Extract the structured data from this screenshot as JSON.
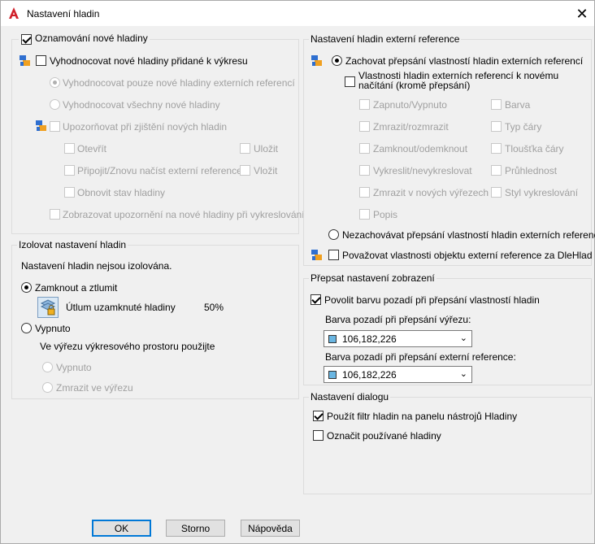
{
  "window": {
    "title": "Nastavení hladin",
    "close_icon": "close-icon"
  },
  "new_layers": {
    "legend": "Oznamování nové hladiny",
    "evaluate": "Vyhodnocovat nové hladiny přidané k výkresu",
    "eval_xref": "Vyhodnocovat pouze nové hladiny externích referencí",
    "eval_all": "Vyhodnocovat všechny nové hladiny",
    "notify": "Upozorňovat při zjištění nových hladin",
    "open": "Otevřít",
    "save": "Uložit",
    "attach": "Připojit/Znovu načíst externí reference",
    "insert": "Vložit",
    "restore": "Obnovit stav hladiny",
    "show_warning": "Zobrazovat upozornění na nové hladiny při vykreslování"
  },
  "isolate": {
    "legend": "Izolovat nastavení hladin",
    "status": "Nastavení hladin nejsou izolována.",
    "lock_fade": "Zamknout a ztlumit",
    "fade_label": "Útlum uzamknuté hladiny",
    "fade_value": "50%",
    "off": "Vypnuto",
    "viewport_text": "Ve výřezu výkresového prostoru použijte",
    "vp_off": "Vypnuto",
    "vp_freeze": "Zmrazit ve výřezu"
  },
  "xref": {
    "legend": "Nastavení hladin externí reference",
    "keep": "Zachovat přepsání vlastností hladin externích referencí",
    "reload_line1": "Vlastnosti hladin externích referencí k novému",
    "reload_line2": "načítání (kromě přepsání)",
    "col1": [
      "Zapnuto/Vypnuto",
      "Zmrazit/rozmrazit",
      "Zamknout/odemknout",
      "Vykreslit/nevykreslovat",
      "Zmrazit v nových výřezech",
      "Popis"
    ],
    "col2": [
      "Barva",
      "Typ čáry",
      "Tloušťka čáry",
      "Průhlednost",
      "Styl vykreslování"
    ],
    "not_keep": "Nezachovávat přepsání vlastností hladin externích referencí",
    "treat": "Považovat vlastnosti objektu externí reference za DleHlad"
  },
  "override": {
    "legend": "Přepsat nastavení zobrazení",
    "enable": "Povolit barvu pozadí při přepsání vlastností hladin",
    "vp_label": "Barva pozadí při přepsání výřezu:",
    "vp_color": "106,182,226",
    "xref_label": "Barva pozadí při přepsání externí reference:",
    "xref_color": "106,182,226",
    "swatch_color": "#6ab6e2"
  },
  "dialog": {
    "legend": "Nastavení dialogu",
    "filter": "Použít filtr hladin na panelu nástrojů Hladiny",
    "mark": "Označit používané hladiny"
  },
  "buttons": {
    "ok": "OK",
    "cancel": "Storno",
    "help": "Nápověda"
  }
}
